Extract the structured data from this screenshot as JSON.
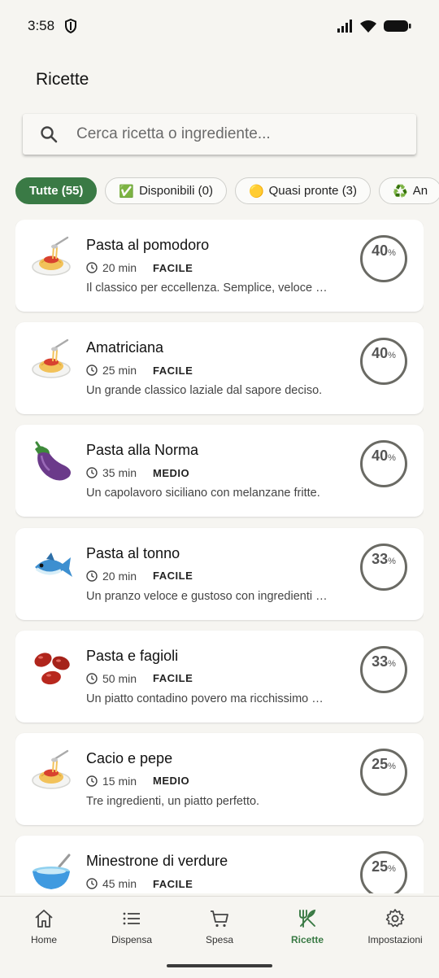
{
  "status": {
    "time": "3:58"
  },
  "header": {
    "title": "Ricette"
  },
  "search": {
    "placeholder": "Cerca ricetta o ingrediente..."
  },
  "filters": [
    {
      "label": "Tutte (55)",
      "emoji": "",
      "active": true
    },
    {
      "label": "Disponibili (0)",
      "emoji": "✅",
      "active": false
    },
    {
      "label": "Quasi pronte (3)",
      "emoji": "🟡",
      "active": false
    },
    {
      "label": "An",
      "emoji": "♻️",
      "active": false
    }
  ],
  "recipes": [
    {
      "title": "Pasta al pomodoro",
      "time": "20 min",
      "difficulty": "FACILE",
      "description": "Il classico per eccellenza. Semplice, veloce …",
      "percent": "40",
      "icon": "spaghetti-icon"
    },
    {
      "title": "Amatriciana",
      "time": "25 min",
      "difficulty": "FACILE",
      "description": "Un grande classico laziale dal sapore deciso.",
      "percent": "40",
      "icon": "spaghetti-icon"
    },
    {
      "title": "Pasta alla Norma",
      "time": "35 min",
      "difficulty": "MEDIO",
      "description": "Un capolavoro siciliano con melanzane fritte.",
      "percent": "40",
      "icon": "eggplant-icon"
    },
    {
      "title": "Pasta al tonno",
      "time": "20 min",
      "difficulty": "FACILE",
      "description": "Un pranzo veloce e gustoso con ingredienti …",
      "percent": "33",
      "icon": "fish-icon"
    },
    {
      "title": "Pasta e fagioli",
      "time": "50 min",
      "difficulty": "FACILE",
      "description": "Un piatto contadino povero ma ricchissimo …",
      "percent": "33",
      "icon": "beans-icon"
    },
    {
      "title": "Cacio e pepe",
      "time": "15 min",
      "difficulty": "MEDIO",
      "description": "Tre ingredienti, un piatto perfetto.",
      "percent": "25",
      "icon": "spaghetti-icon"
    },
    {
      "title": "Minestrone di verdure",
      "time": "45 min",
      "difficulty": "FACILE",
      "description": "",
      "percent": "25",
      "icon": "soup-bowl-icon"
    }
  ],
  "percent_suffix": "%",
  "nav": [
    {
      "label": "Home",
      "icon": "home-icon",
      "active": false
    },
    {
      "label": "Dispensa",
      "icon": "list-icon",
      "active": false
    },
    {
      "label": "Spesa",
      "icon": "cart-icon",
      "active": false
    },
    {
      "label": "Ricette",
      "icon": "utensils-icon",
      "active": true
    },
    {
      "label": "Impostazioni",
      "icon": "gear-icon",
      "active": false
    }
  ],
  "colors": {
    "accent": "#3a7a45",
    "background": "#f6f5f1",
    "ring": "#6a6a64"
  }
}
